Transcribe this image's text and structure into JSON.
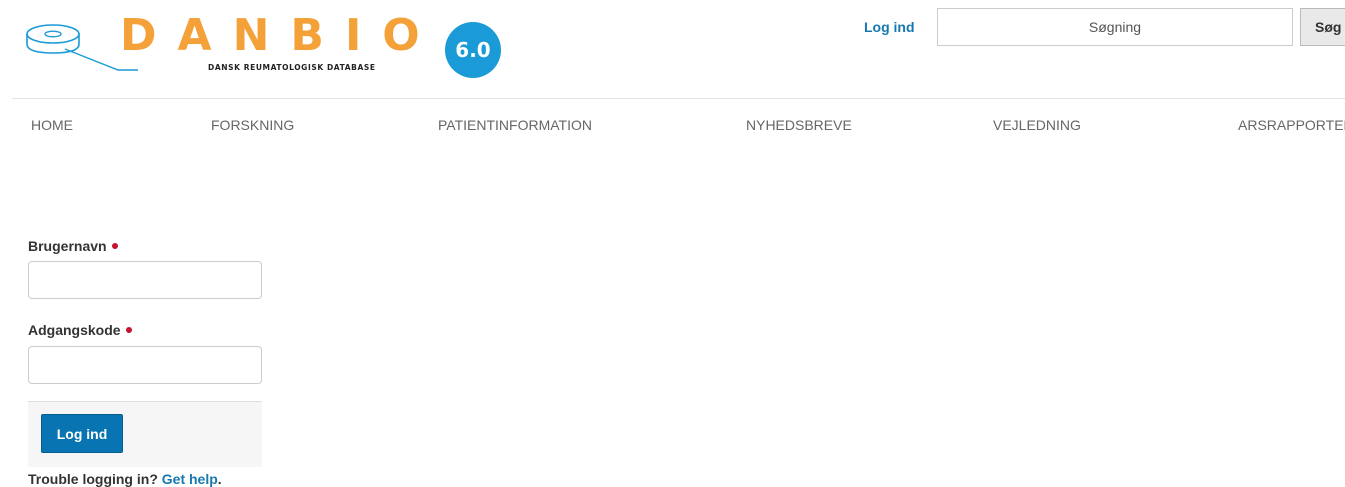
{
  "brand": {
    "name": "DANBIO",
    "subtitle": "DANSK REUMATOLOGISK DATABASE",
    "version": "6.0",
    "colors": {
      "letters": "#f5a13a",
      "badge": "#1a9ad6",
      "icon_stroke": "#1a9ad6"
    }
  },
  "header": {
    "login_link": "Log ind",
    "search": {
      "placeholder": "Søgning",
      "value": "",
      "button": "Søg"
    }
  },
  "nav": {
    "items": [
      {
        "label": "HOME"
      },
      {
        "label": "FORSKNING"
      },
      {
        "label": "PATIENTINFORMATION"
      },
      {
        "label": "NYHEDSBREVE"
      },
      {
        "label": "VEJLEDNING"
      },
      {
        "label": "ARSRAPPORTER"
      }
    ]
  },
  "form": {
    "username": {
      "label": "Brugernavn",
      "value": ""
    },
    "password": {
      "label": "Adgangskode",
      "value": ""
    },
    "submit": "Log ind",
    "help_prefix": "Trouble logging in?",
    "help_link": "Get help",
    "help_suffix": "."
  },
  "colors": {
    "link": "#1678ae",
    "primary_button": "#0874b1",
    "required": "#c4122f"
  }
}
